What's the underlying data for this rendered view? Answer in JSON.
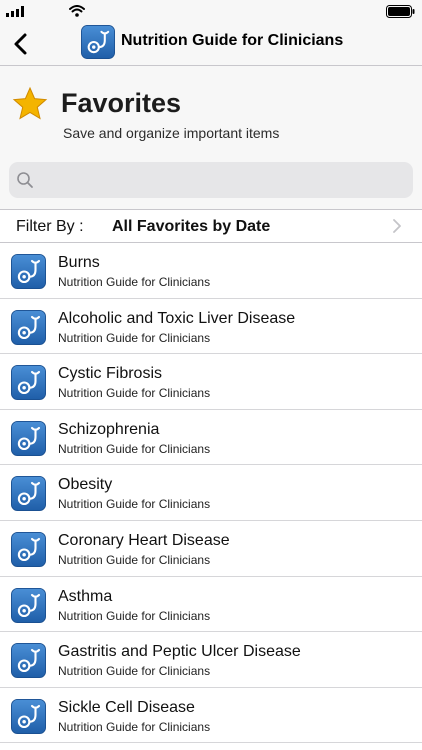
{
  "nav": {
    "title": "Nutrition Guide for Clinicians"
  },
  "header": {
    "title": "Favorites",
    "subtitle": "Save and organize important items"
  },
  "search": {
    "placeholder": "",
    "value": ""
  },
  "filter": {
    "label": "Filter By :",
    "value": "All Favorites by Date"
  },
  "colors": {
    "app_icon_blue": "#2a6cb7",
    "star_yellow": "#f4b400",
    "chrome_gray": "#f7f7f7"
  },
  "items": [
    {
      "title": "Burns",
      "subtitle": "Nutrition Guide for Clinicians",
      "icon": "stethoscope-app-icon"
    },
    {
      "title": "Alcoholic and Toxic Liver Disease",
      "subtitle": "Nutrition Guide for Clinicians",
      "icon": "stethoscope-app-icon"
    },
    {
      "title": "Cystic Fibrosis",
      "subtitle": "Nutrition Guide for Clinicians",
      "icon": "stethoscope-app-icon"
    },
    {
      "title": "Schizophrenia",
      "subtitle": "Nutrition Guide for Clinicians",
      "icon": "stethoscope-app-icon"
    },
    {
      "title": "Obesity",
      "subtitle": "Nutrition Guide for Clinicians",
      "icon": "stethoscope-app-icon"
    },
    {
      "title": "Coronary Heart Disease",
      "subtitle": "Nutrition Guide for Clinicians",
      "icon": "stethoscope-app-icon"
    },
    {
      "title": "Asthma",
      "subtitle": "Nutrition Guide for Clinicians",
      "icon": "stethoscope-app-icon"
    },
    {
      "title": "Gastritis and Peptic Ulcer Disease",
      "subtitle": "Nutrition Guide for Clinicians",
      "icon": "stethoscope-app-icon"
    },
    {
      "title": "Sickle Cell Disease",
      "subtitle": "Nutrition Guide for Clinicians",
      "icon": "stethoscope-app-icon"
    }
  ]
}
